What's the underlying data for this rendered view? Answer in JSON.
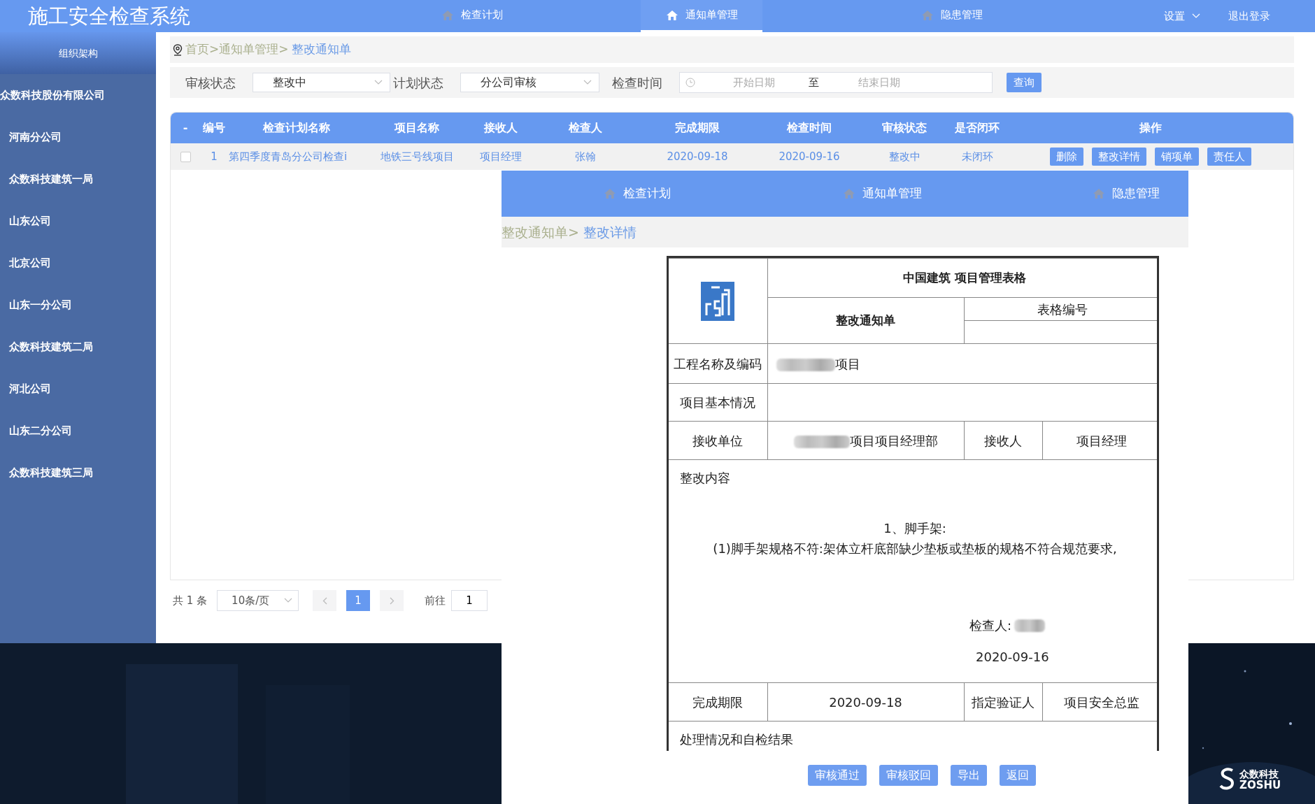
{
  "header": {
    "title": "施工安全检查系统",
    "nav": [
      {
        "label": "检查计划",
        "selected": false
      },
      {
        "label": "通知单管理",
        "selected": true
      },
      {
        "label": "隐患管理",
        "selected": false
      }
    ],
    "settings": "设置",
    "logout": "退出登录"
  },
  "sidebar": {
    "title": "组织架构",
    "tree": [
      {
        "label": "众数科技股份有限公司",
        "children": [
          {
            "label": "河南分公司"
          },
          {
            "label": "众数科技建筑一局"
          },
          {
            "label": "山东公司"
          },
          {
            "label": "北京公司"
          },
          {
            "label": "山东一分公司"
          },
          {
            "label": "众数科技建筑二局"
          },
          {
            "label": "河北公司"
          },
          {
            "label": "山东二分公司"
          },
          {
            "label": "众数科技建筑三局"
          }
        ]
      }
    ]
  },
  "breadcrumb": {
    "path": "首页>通知单管理>",
    "current": "整改通知单"
  },
  "filters": [
    {
      "kind": "select",
      "label": "审核状态",
      "value": "整改中"
    },
    {
      "kind": "select",
      "label": "计划状态",
      "value": "分公司审核"
    },
    {
      "kind": "daterange",
      "label": "检查时间",
      "start_placeholder": "开始日期",
      "separator": "至",
      "end_placeholder": "结束日期"
    }
  ],
  "query_button": "查询",
  "table": {
    "toggle": "-",
    "columns": [
      "编号",
      "检查计划名称",
      "项目名称",
      "接收人",
      "检查人",
      "完成期限",
      "检查时间",
      "审核状态",
      "是否闭环",
      "操作"
    ],
    "rows": [
      {
        "checked": false,
        "cells": [
          "1",
          "第四季度青岛分公司检查i",
          "地铁三号线项目",
          "项目经理",
          "张翰",
          "2020-09-18",
          "2020-09-16",
          "整改中",
          "未闭环"
        ],
        "actions": [
          "删除",
          "整改详情",
          "销项单",
          "责任人"
        ]
      }
    ]
  },
  "pagination": {
    "total": "共 1 条",
    "page_size": "10条/页",
    "pages": [
      {
        "label": "1",
        "selected": true
      }
    ],
    "goto_label": "前往",
    "goto_value": "1"
  },
  "detail_window": {
    "nav": [
      {
        "label": "检查计划",
        "selected": false
      },
      {
        "label": "通知单管理",
        "selected": false
      },
      {
        "label": "隐患管理",
        "selected": false
      }
    ],
    "breadcrumb": {
      "path": "整改通知单>",
      "current": "整改详情"
    },
    "form": {
      "company_title": "中国建筑 项目管理表格",
      "form_title": "整改通知单",
      "form_no_label": "表格编号",
      "project_label": "工程名称及编码",
      "project_value": "项目",
      "basic_info_label": "项目基本情况",
      "unit_label": "接收单位",
      "unit_value": "项目项目经理部",
      "receiver_label": "接收人",
      "receiver_value": "项目经理",
      "content_label": "整改内容",
      "content_lines": [
        "1、脚手架:",
        "(1)脚手架规格不符:架体立杆底部缺少垫板或垫板的规格不符合规范要求,"
      ],
      "inspector_label": "检查人:",
      "inspect_date": "2020-09-16",
      "deadline_label": "完成期限",
      "deadline": "2020-09-18",
      "verifier_label": "指定验证人",
      "verifier": "项目安全总监",
      "result_label": "处理情况和自检结果"
    },
    "buttons": [
      "审核通过",
      "审核驳回",
      "导出",
      "返回"
    ]
  },
  "brand": {
    "name": "众数科技",
    "latin": "ZOSHU"
  }
}
